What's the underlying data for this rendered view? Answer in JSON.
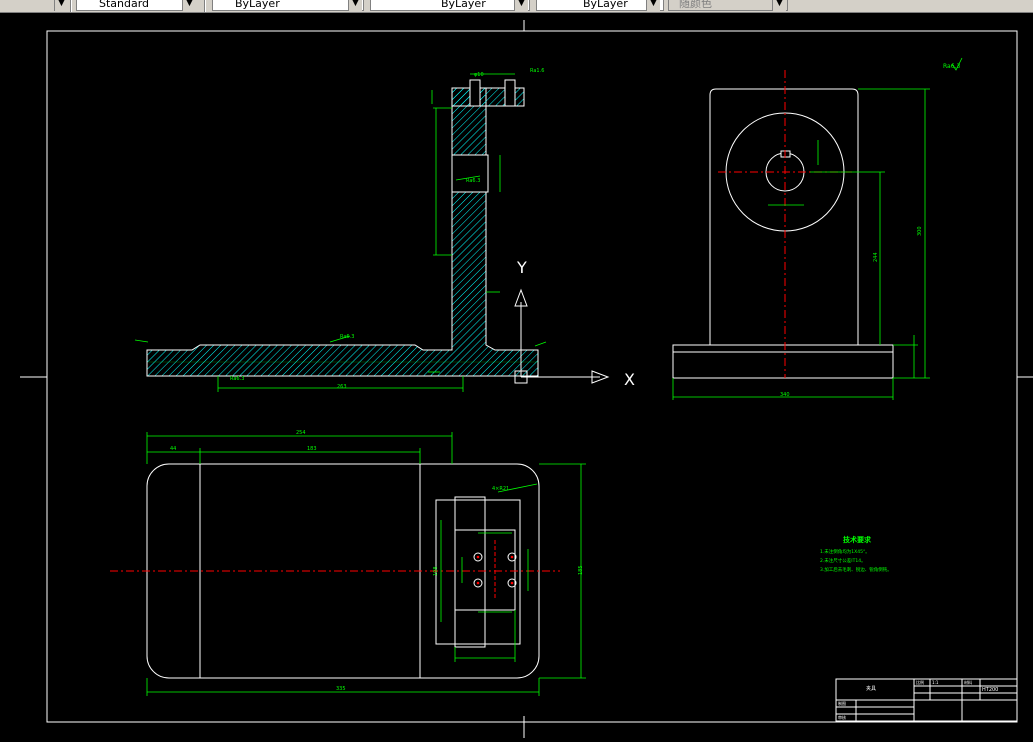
{
  "toolbar": {
    "text_style": "Standard",
    "color": "ByLayer",
    "linetype": "ByLayer",
    "lineweight": "ByLayer",
    "plotstyle": "随颜色"
  },
  "drawing": {
    "ucs_y": "Y",
    "ucs_x": "X",
    "dims": {
      "top_width": "254",
      "top_left": "44",
      "top_mid": "183",
      "bottom_width": "335",
      "right_height": "185",
      "inner_height": "108",
      "section_bottom": "263",
      "side_bottom": "340",
      "side_height": "300",
      "side_hole": "244"
    },
    "notes": {
      "title": "技术要求",
      "line1": "1.未注倒角均为1X45°。",
      "line2": "2.未注尺寸公差IT14。",
      "line3": "3.加工后去毛刺、锐边、锐角倒钝。"
    },
    "title_block": {
      "label_a": "比例",
      "label_b": "1:1",
      "label_c": "材料",
      "label_d": "HT200",
      "label_e": "制图",
      "label_f": "审核",
      "label_g": "夹具"
    }
  }
}
